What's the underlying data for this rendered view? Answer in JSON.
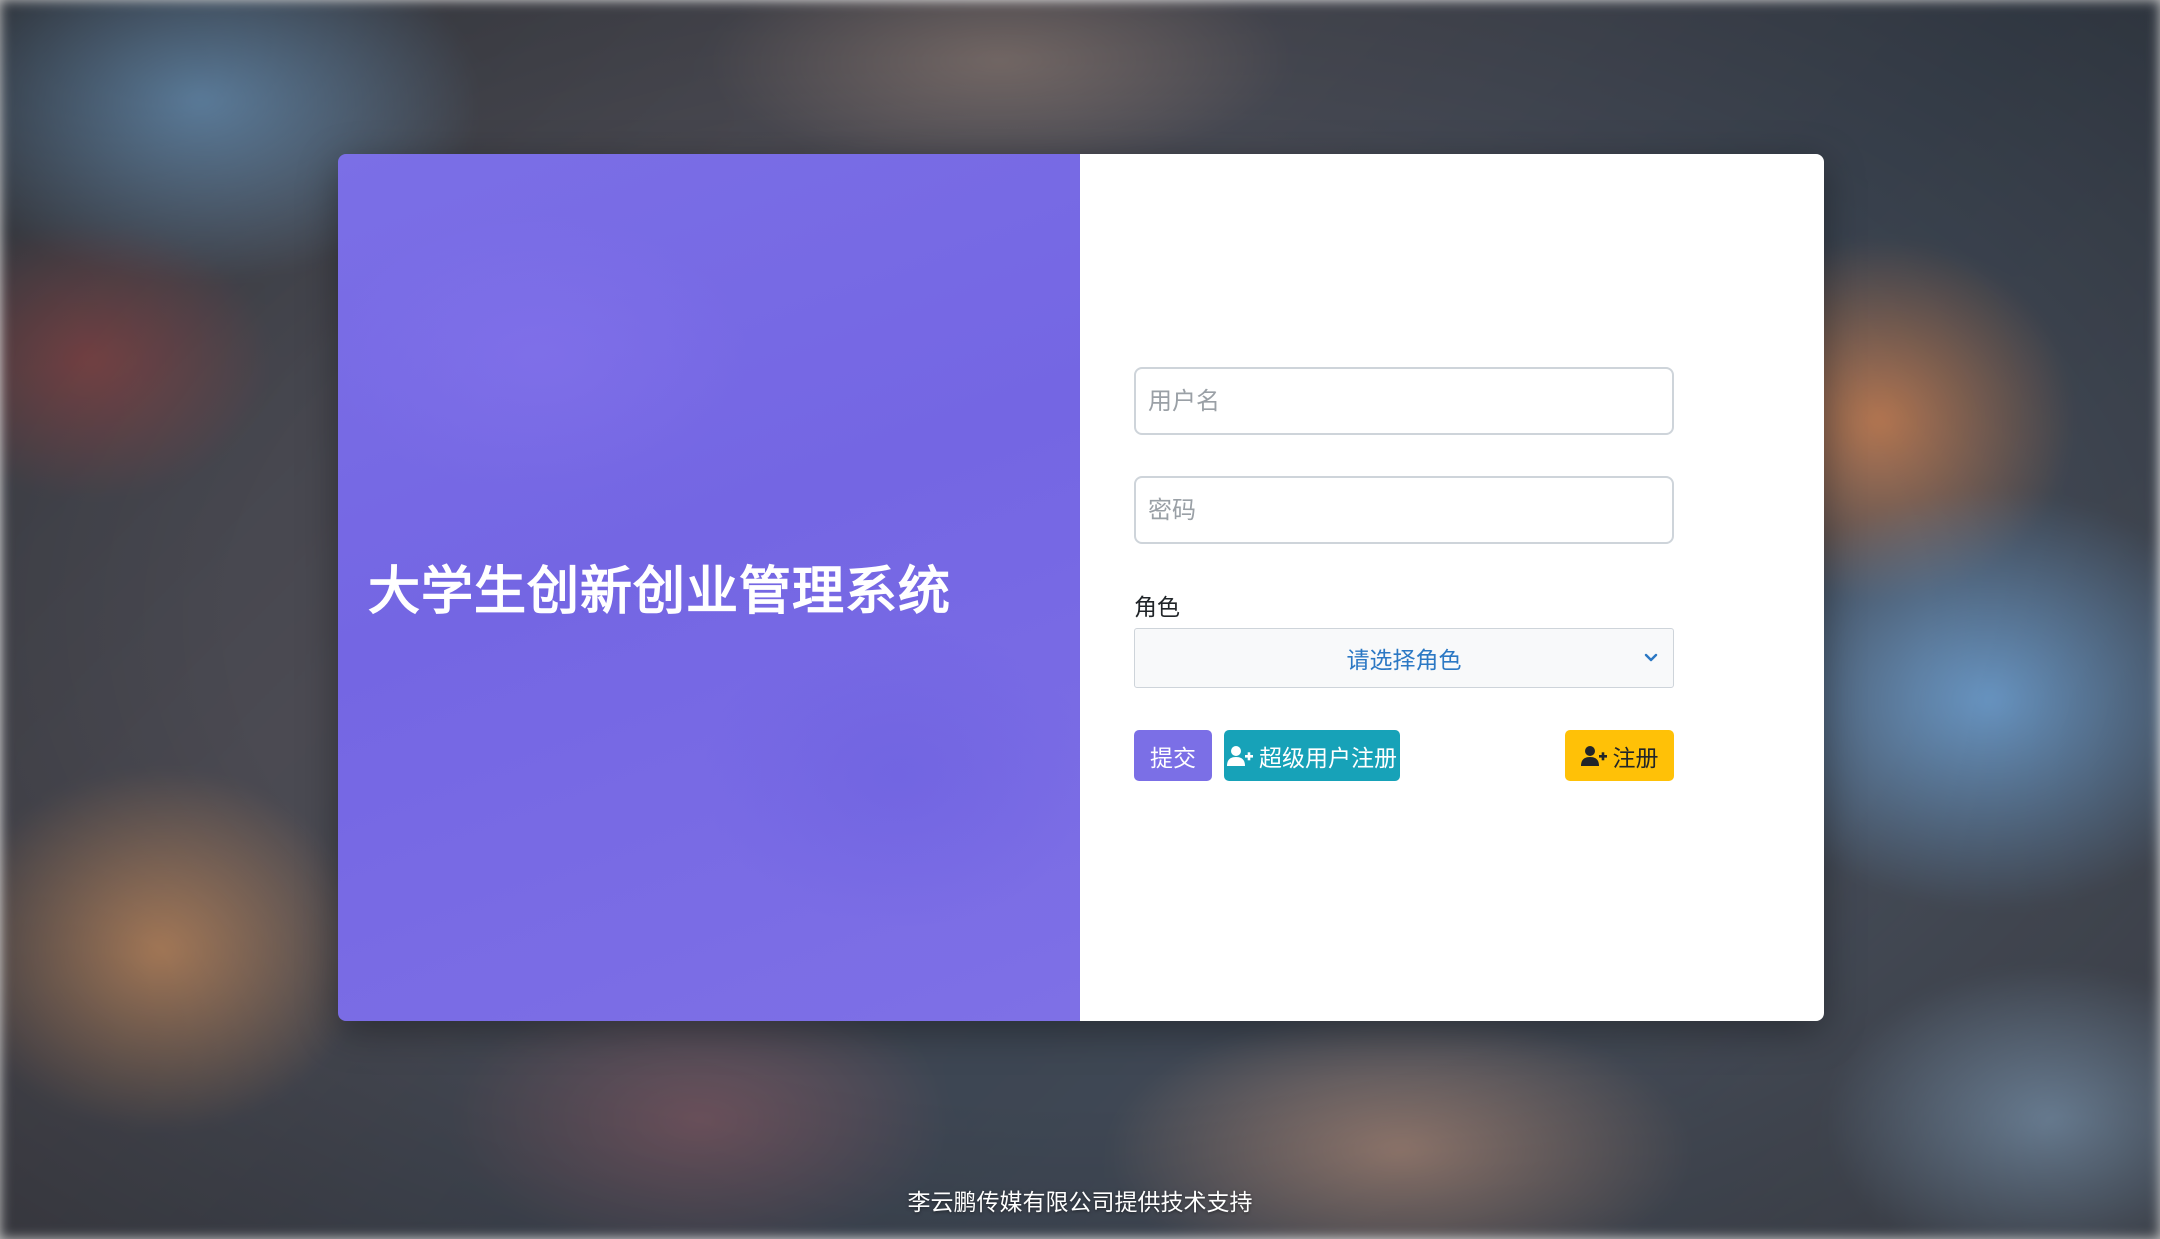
{
  "app": {
    "title": "大学生创新创业管理系统"
  },
  "login_form": {
    "username_placeholder": "用户名",
    "password_placeholder": "密码",
    "role_label": "角色",
    "role_selected": "请选择角色"
  },
  "buttons": {
    "submit_label": "提交",
    "super_register_label": "超级用户注册",
    "register_label": "注册"
  },
  "footer": {
    "text": "李云鹏传媒有限公司提供技术支持"
  },
  "icons": {
    "role_dropdown": "chevron-down-icon",
    "super_register": "user-plus-icon",
    "register": "user-plus-icon"
  },
  "colors": {
    "primary": "#7b6fe6",
    "info": "#17a2b8",
    "warning": "#ffc107",
    "select_text": "#2b78c4"
  }
}
